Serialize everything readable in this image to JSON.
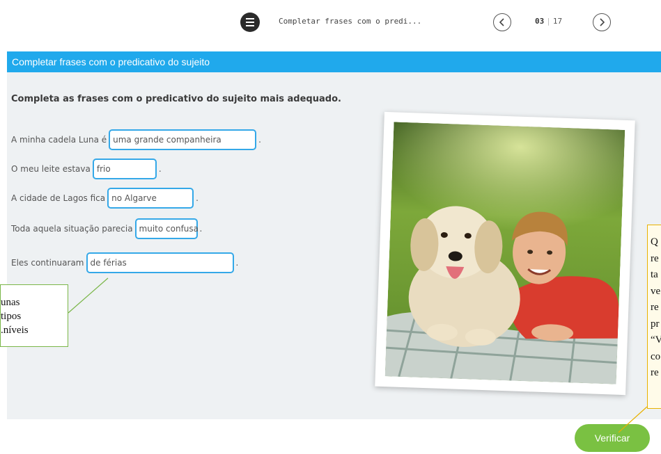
{
  "topbar": {
    "title": "Completar frases com o predi...",
    "current_page": "03",
    "separator": "|",
    "total_pages": "17",
    "menu_icon": "list-icon",
    "prev_icon": "chevron-left-icon",
    "next_icon": "chevron-right-icon"
  },
  "header": {
    "title": "Completar frases com o predicativo do sujeito"
  },
  "exercise": {
    "instruction": "Completa as frases com o predicativo do sujeito mais adequado.",
    "sentences": [
      {
        "prefix": "A minha cadela Luna é",
        "answer": "uma grande companheira",
        "suffix": "."
      },
      {
        "prefix": "O meu leite estava",
        "answer": "frio",
        "suffix": "."
      },
      {
        "prefix": "A cidade de Lagos fica",
        "answer": "no Algarve",
        "suffix": "."
      },
      {
        "prefix": "Toda aquela situação parecia",
        "answer": "muito confusa",
        "suffix": "."
      },
      {
        "prefix": "Eles continuaram",
        "answer": "de férias",
        "suffix": "."
      }
    ]
  },
  "footer": {
    "verify_label": "Verificar"
  },
  "callouts": {
    "left_lines": [
      "unas",
      "tipos",
      "níveis."
    ],
    "right_lines": [
      "Q",
      "re",
      "ta",
      "ve",
      "re",
      "pr",
      "“V",
      "co",
      "re"
    ]
  },
  "colors": {
    "header_band": "#20a9ec",
    "input_border": "#34a8e8",
    "verify_button": "#7ac142",
    "panel_bg": "#eef1f3",
    "callout_left_border": "#7ab648",
    "callout_right_border": "#e8b100"
  }
}
